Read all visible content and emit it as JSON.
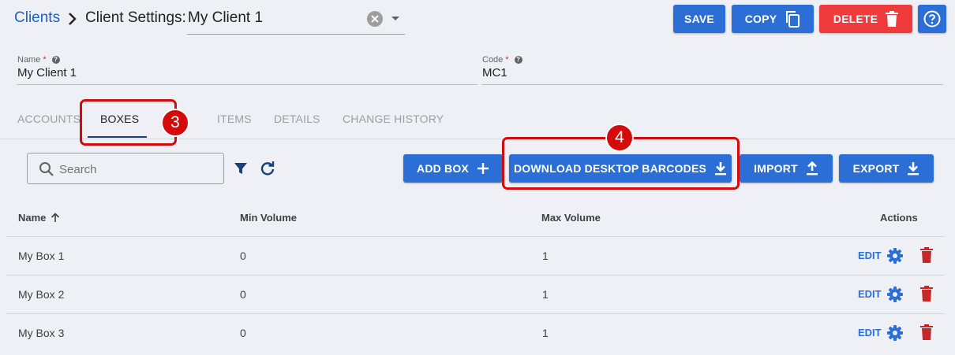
{
  "header": {
    "breadcrumb_link": "Clients",
    "title": "Client Settings:",
    "client_select_value": "My Client 1",
    "buttons": {
      "save": "SAVE",
      "copy": "COPY",
      "delete": "DELETE"
    }
  },
  "form": {
    "name_label": "Name",
    "name_value": "My Client 1",
    "code_label": "Code",
    "code_value": "MC1",
    "required_mark": "*"
  },
  "tabs": [
    {
      "label": "ACCOUNTS"
    },
    {
      "label": "BOXES"
    },
    {
      "label": "ITEMS"
    },
    {
      "label": "DETAILS"
    },
    {
      "label": "CHANGE HISTORY"
    }
  ],
  "active_tab": "BOXES",
  "callouts": [
    "3",
    "4"
  ],
  "toolbar": {
    "search_placeholder": "Search",
    "add_box": "ADD BOX",
    "download_barcodes": "DOWNLOAD DESKTOP BARCODES",
    "import": "IMPORT",
    "export": "EXPORT"
  },
  "table": {
    "columns": [
      "Name",
      "Min Volume",
      "Max Volume",
      "Actions"
    ],
    "sort_column": "Name",
    "sort_direction": "ascending",
    "edit_label": "EDIT",
    "rows": [
      {
        "name": "My Box 1",
        "min": "0",
        "max": "1"
      },
      {
        "name": "My Box 2",
        "min": "0",
        "max": "1"
      },
      {
        "name": "My Box 3",
        "min": "0",
        "max": "1"
      }
    ]
  },
  "colors": {
    "primary": "#2b6fd6",
    "danger": "#ef3b3b",
    "callout": "#d30b0b",
    "background": "#eef0f5"
  }
}
